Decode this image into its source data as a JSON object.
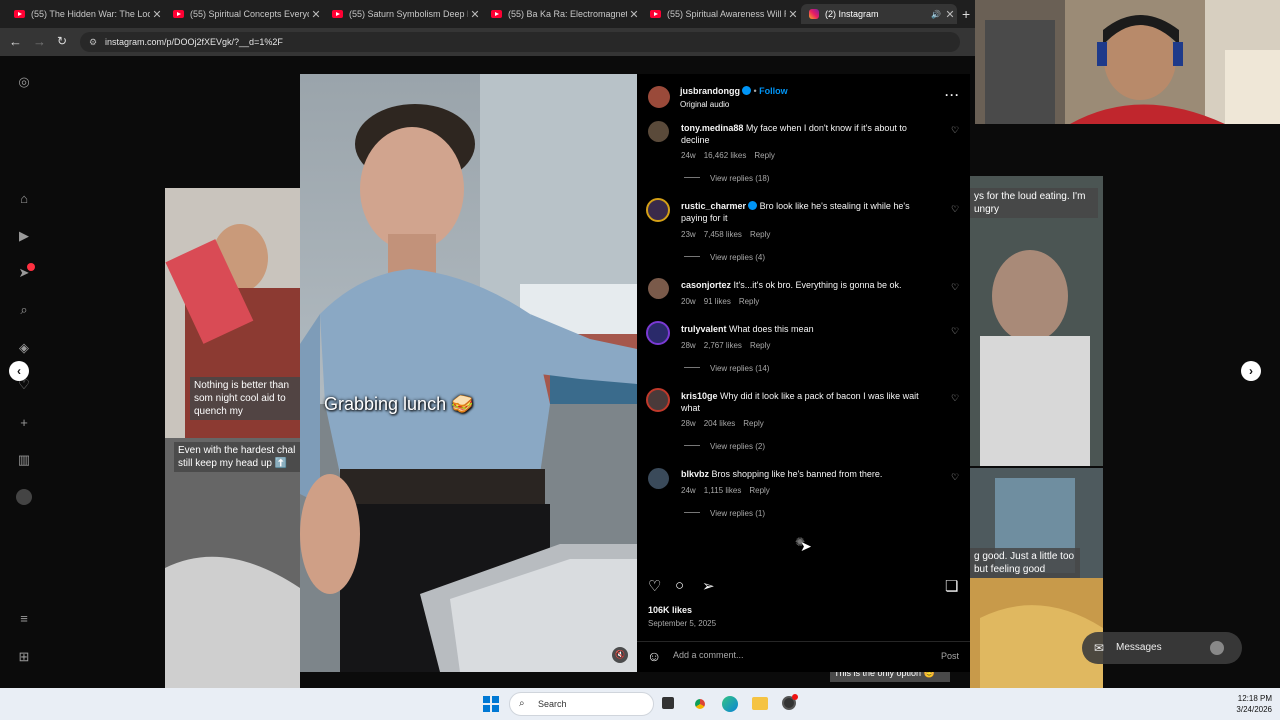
{
  "browser": {
    "tabs": [
      {
        "label": "(55) The Hidden War: The Loosh",
        "kind": "youtube"
      },
      {
        "label": "(55) Spiritual Concepts Everyone",
        "kind": "youtube"
      },
      {
        "label": "(55) Saturn Symbolism Deep Di",
        "kind": "youtube"
      },
      {
        "label": "(55) Ba Ka Ra: Electromagnetic",
        "kind": "youtube"
      },
      {
        "label": "(55) Spiritual Awareness Will Ru",
        "kind": "youtube"
      },
      {
        "label": "(2) Instagram",
        "kind": "instagram",
        "active": true
      }
    ],
    "url": "instagram.com/p/DOOj2fXEVgk/?__d=1%2F"
  },
  "post": {
    "username": "jusbrandongg",
    "follow_label": "Follow",
    "audio": "Original audio",
    "video_caption": "Grabbing lunch 🥪",
    "likes": "106K likes",
    "date": "September 5, 2025",
    "comment_placeholder": "Add a comment...",
    "post_label": "Post"
  },
  "comments": [
    {
      "user": "tony.medina88",
      "text": "My face when I don't know if it's about to decline",
      "age": "24w",
      "likes": "16,462 likes",
      "reply": "Reply",
      "view_replies": "View replies (18)",
      "avatar_color": "#5a4a3a"
    },
    {
      "user": "rustic_charmer",
      "verified": true,
      "text": "Bro look like he's stealing it while he's paying for it",
      "age": "23w",
      "likes": "7,458 likes",
      "reply": "Reply",
      "view_replies": "View replies (4)",
      "avatar_color": "#3a2a4a"
    },
    {
      "user": "casonjortez",
      "text": "It's...it's ok bro. Everything is gonna be ok.",
      "age": "20w",
      "likes": "91 likes",
      "reply": "Reply",
      "view_replies": "",
      "avatar_color": "#7a5a4a"
    },
    {
      "user": "trulyvalent",
      "text": "What does this mean",
      "age": "28w",
      "likes": "2,767 likes",
      "reply": "Reply",
      "view_replies": "View replies (14)",
      "avatar_color": "#2a2a6a"
    },
    {
      "user": "kris10ge",
      "text": "Why did it look like a pack of bacon I was like wait what",
      "age": "28w",
      "likes": "204 likes",
      "reply": "Reply",
      "view_replies": "View replies (2)",
      "avatar_color": "#4a3a3a"
    },
    {
      "user": "blkvbz",
      "text": "Bros shopping like he's banned from there.",
      "age": "24w",
      "likes": "1,115 likes",
      "reply": "Reply",
      "view_replies": "View replies (1)",
      "avatar_color": "#3a4a5a"
    }
  ],
  "background_captions": {
    "left_1": "Nothing is better than som night cool aid to quench my",
    "left_2": "Even with the hardest chal still keep my head up ⬆️",
    "right_1": "ys for the loud eating. I'm ungry",
    "right_2": "g good. Just a little too but feeling good",
    "bottom": "This is the only option 😊"
  },
  "messages": {
    "label": "Messages"
  },
  "taskbar": {
    "search_label": "Search",
    "time": "12:18 PM",
    "date": "3/24/2026"
  },
  "icons": {
    "rail": [
      "instagram-icon",
      "home-icon",
      "reels-icon",
      "explore-icon",
      "search-icon",
      "compass-icon",
      "heart-icon",
      "create-icon",
      "dashboard-icon",
      "profile-icon",
      "menu-icon",
      "apps-icon"
    ]
  }
}
